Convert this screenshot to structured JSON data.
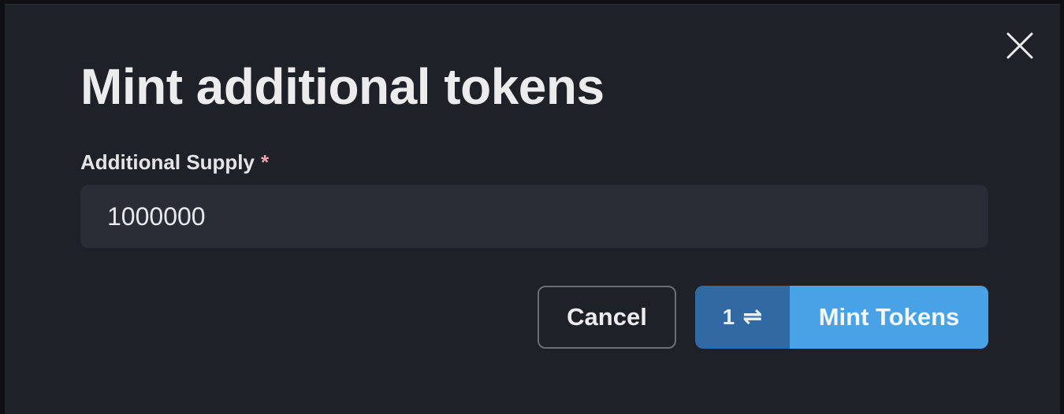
{
  "modal": {
    "title": "Mint additional tokens",
    "field": {
      "label": "Additional Supply",
      "required_marker": "*",
      "value": "1000000"
    },
    "actions": {
      "cancel_label": "Cancel",
      "tx_count": "1",
      "tx_icon": "swap-arrows-icon",
      "submit_label": "Mint Tokens"
    },
    "close_icon": "close-icon"
  },
  "colors": {
    "modal_bg": "#1e2128",
    "input_bg": "#292d36",
    "primary": "#4aa2e6",
    "primary_dark": "#3169a3",
    "required": "#e9a6a6"
  }
}
